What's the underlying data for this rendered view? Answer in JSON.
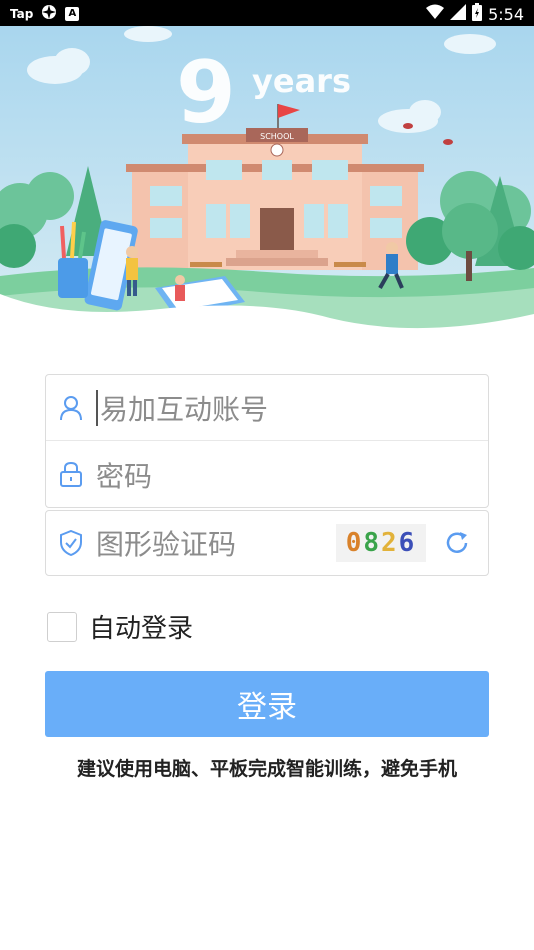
{
  "status_bar": {
    "carrier": "Tap",
    "time": "5:54",
    "left_icons": [
      "tap-label",
      "wheel-icon",
      "a-icon"
    ],
    "right_icons": [
      "wifi-icon",
      "signal-icon",
      "battery-icon"
    ]
  },
  "banner": {
    "number": "9",
    "years_text": "years",
    "school_sign": "SCHOOL"
  },
  "form": {
    "account_placeholder": "易加互动账号",
    "password_placeholder": "密码",
    "captcha_placeholder": "图形验证码",
    "captcha_code": [
      "0",
      "8",
      "2",
      "6"
    ],
    "captcha_colors": [
      "#d9822b",
      "#3aa34a",
      "#e2b23a",
      "#3c4fb8"
    ]
  },
  "auto_login": {
    "label": "自动登录",
    "checked": false
  },
  "login_button": {
    "label": "登录",
    "color": "#69aef9"
  },
  "tip": "建议使用电脑、平板完成智能训练，避免手机"
}
